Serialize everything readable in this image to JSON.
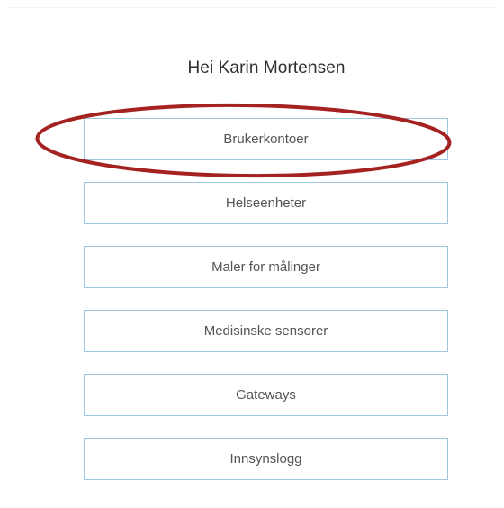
{
  "greeting": "Hei Karin Mortensen",
  "menu": {
    "items": [
      {
        "label": "Brukerkontoer"
      },
      {
        "label": "Helseenheter"
      },
      {
        "label": "Maler for målinger"
      },
      {
        "label": "Medisinske sensorer"
      },
      {
        "label": "Gateways"
      },
      {
        "label": "Innsynslogg"
      }
    ]
  },
  "colors": {
    "button_border": "#9fc6e3",
    "annotation_ellipse": "#a42320",
    "text": "#555555"
  }
}
